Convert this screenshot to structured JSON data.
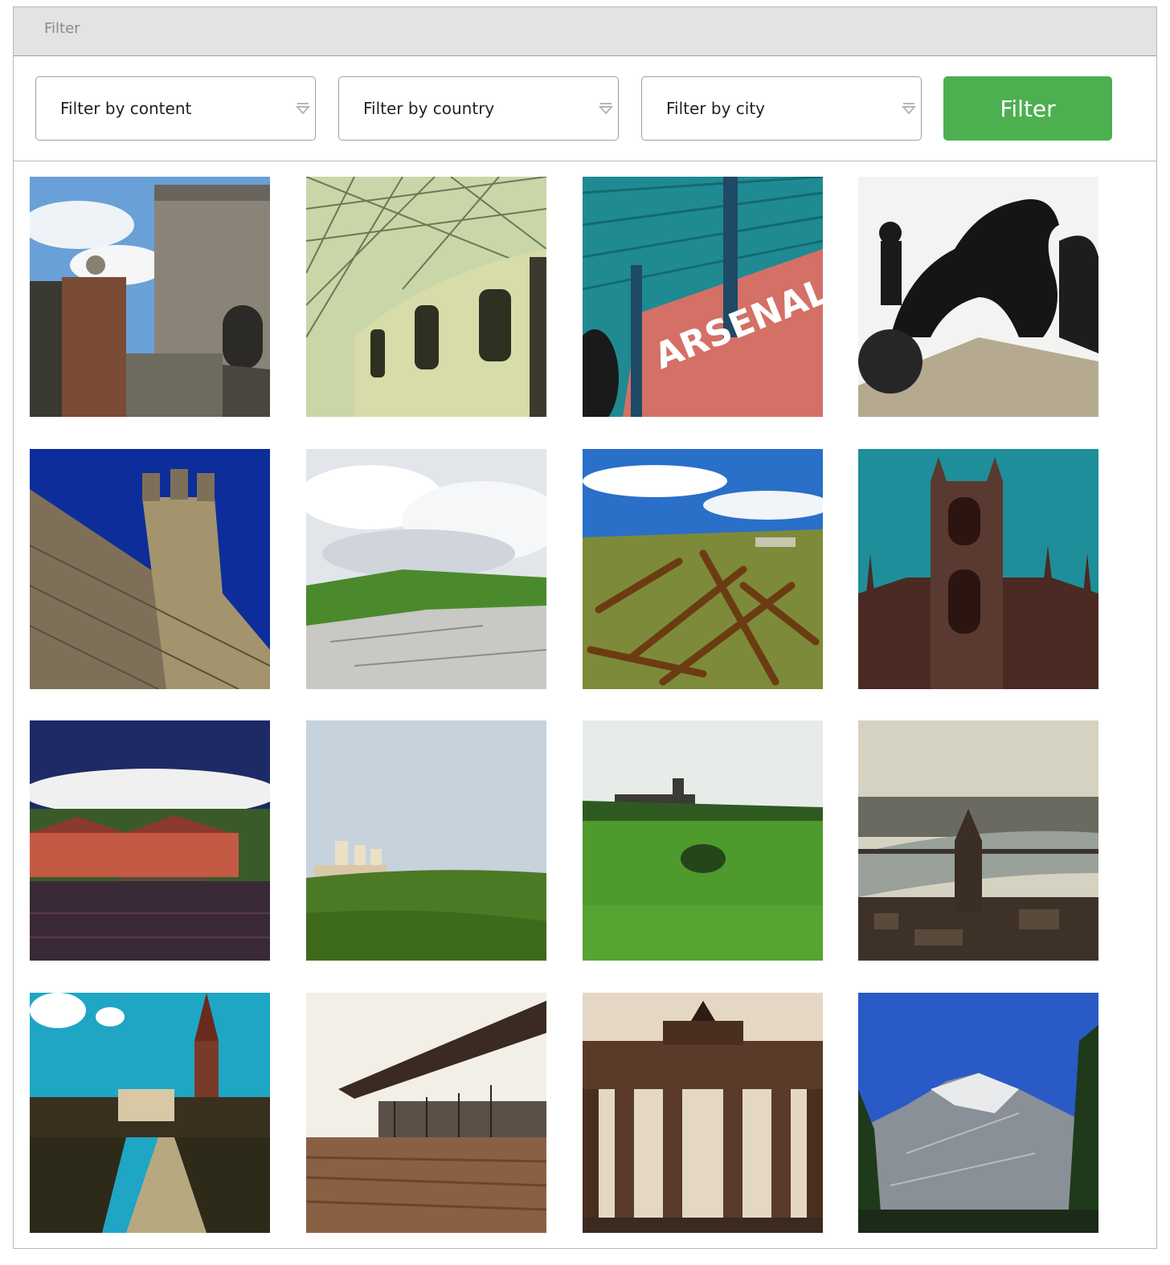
{
  "panel": {
    "title": "Filter"
  },
  "filters": {
    "content_label": "Filter by content",
    "country_label": "Filter by country",
    "city_label": "Filter by city",
    "button_label": "Filter"
  },
  "colors": {
    "header_bg": "#e3e3e1",
    "accent_button": "#4caf50",
    "border": "#b9b9b9"
  },
  "photos": [
    {
      "name": "castle-gate-photo"
    },
    {
      "name": "glass-roof-courtyard-photo"
    },
    {
      "name": "arsenal-stadium-photo"
    },
    {
      "name": "horse-chariot-statue-photo"
    },
    {
      "name": "castle-battlements-photo"
    },
    {
      "name": "rocky-coast-photo"
    },
    {
      "name": "rusty-anchors-photo"
    },
    {
      "name": "gothic-church-photo"
    },
    {
      "name": "harbour-town-photo"
    },
    {
      "name": "field-silos-photo"
    },
    {
      "name": "green-field-church-photo"
    },
    {
      "name": "river-city-view-photo"
    },
    {
      "name": "palace-garden-photo"
    },
    {
      "name": "modern-gallery-photo"
    },
    {
      "name": "brandenburg-gate-photo"
    },
    {
      "name": "snowy-mountain-photo"
    }
  ],
  "photo_text": {
    "arsenal_sign": "ARSENAL"
  }
}
